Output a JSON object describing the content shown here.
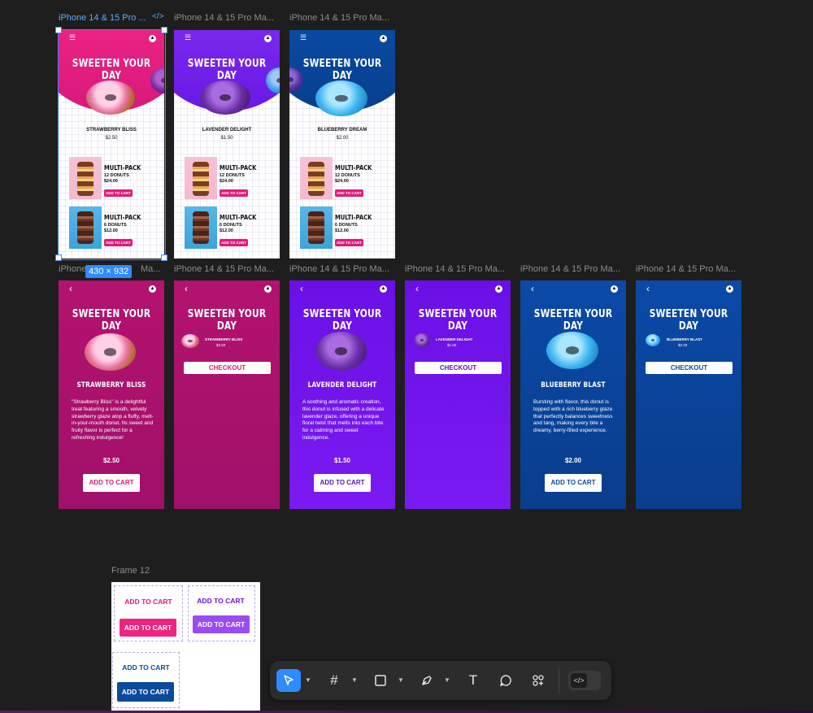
{
  "canvas": {
    "row1_labels": [
      "iPhone 14 & 15 Pro ...",
      "iPhone 14 & 15 Pro Ma...",
      "iPhone 14 & 15 Pro Ma..."
    ],
    "row2_labels": [
      "iPhone 14 & 15 Pro Ma...",
      "iPhone 14 & 15 Pro Ma...",
      "iPhone 14 & 15 Pro Ma...",
      "iPhone 14 & 15 Pro Ma...",
      "iPhone 14 & 15 Pro Ma...",
      "iPhone 14 & 15 Pro Ma...",
      "iPhone 14 & 15 Pro Ma..."
    ],
    "row2_first_label": "iPhone",
    "frame12_label": "Frame 12",
    "selection_size": "430 × 932",
    "code_glyph": "</>"
  },
  "app": {
    "title": "SWEETEN YOUR DAY",
    "add_to_cart": "ADD TO CART",
    "checkout": "CHECKOUT"
  },
  "home_screens": [
    {
      "name": "STRAWBERRY BLISS",
      "price": "$2.50"
    },
    {
      "name": "LAVENDER DELIGHT",
      "price": "$1.50"
    },
    {
      "name": "BLUEBERRY DREAM",
      "price": "$2.00"
    }
  ],
  "packs": [
    {
      "title": "MULTI-PACK",
      "count": "12 DONUTS",
      "price": "$24.00",
      "button": "ADD TO CART"
    },
    {
      "title": "MULTI-PACK",
      "count": "6 DONUTS",
      "price": "$12.00",
      "button": "ADD TO CART"
    }
  ],
  "details": [
    {
      "name": "STRAWBERRY BLISS",
      "price": "$2.50",
      "desc": "\"Strawberry Bliss\" is a delightful treat featuring a smooth, velvety strawberry glaze atop a fluffy, melt-in-your-mouth donut. Its sweet and fruity flavor is perfect for a refreshing indulgence!"
    },
    {
      "name": "LAVENDER DELIGHT",
      "price": "$1.50",
      "desc": "A soothing and aromatic creation, this donut is infused with a delicate lavender glaze, offering a unique floral twist that melts into each bite for a calming and sweet indulgence."
    },
    {
      "name": "BLUEBERRY BLAST",
      "price": "$2.00",
      "desc": "Bursting with flavor, this donut is topped with a rich blueberry glaze that perfectly balances sweetness and tang, making every bite a dreamy, berry-filled experience."
    }
  ],
  "cart_items": [
    {
      "name": "STRAWBERRY BLISS",
      "price": "$2.50"
    },
    {
      "name": "LAVENDER DELIGHT",
      "price": "$1.50"
    },
    {
      "name": "BLUEBERRY BLAST",
      "price": "$2.00"
    }
  ],
  "colors": {
    "pink": "#e3197a",
    "lavender": "#7b1cf0",
    "blue": "#0a4a9c",
    "accent": "#2d8cff"
  },
  "toolbar": {
    "tools": [
      "move-tool",
      "frame-tool",
      "rectangle-tool",
      "pen-tool",
      "text-tool",
      "comment-tool",
      "actions-tool"
    ],
    "text_glyph": "T",
    "dev_mode_glyph": "</>"
  }
}
